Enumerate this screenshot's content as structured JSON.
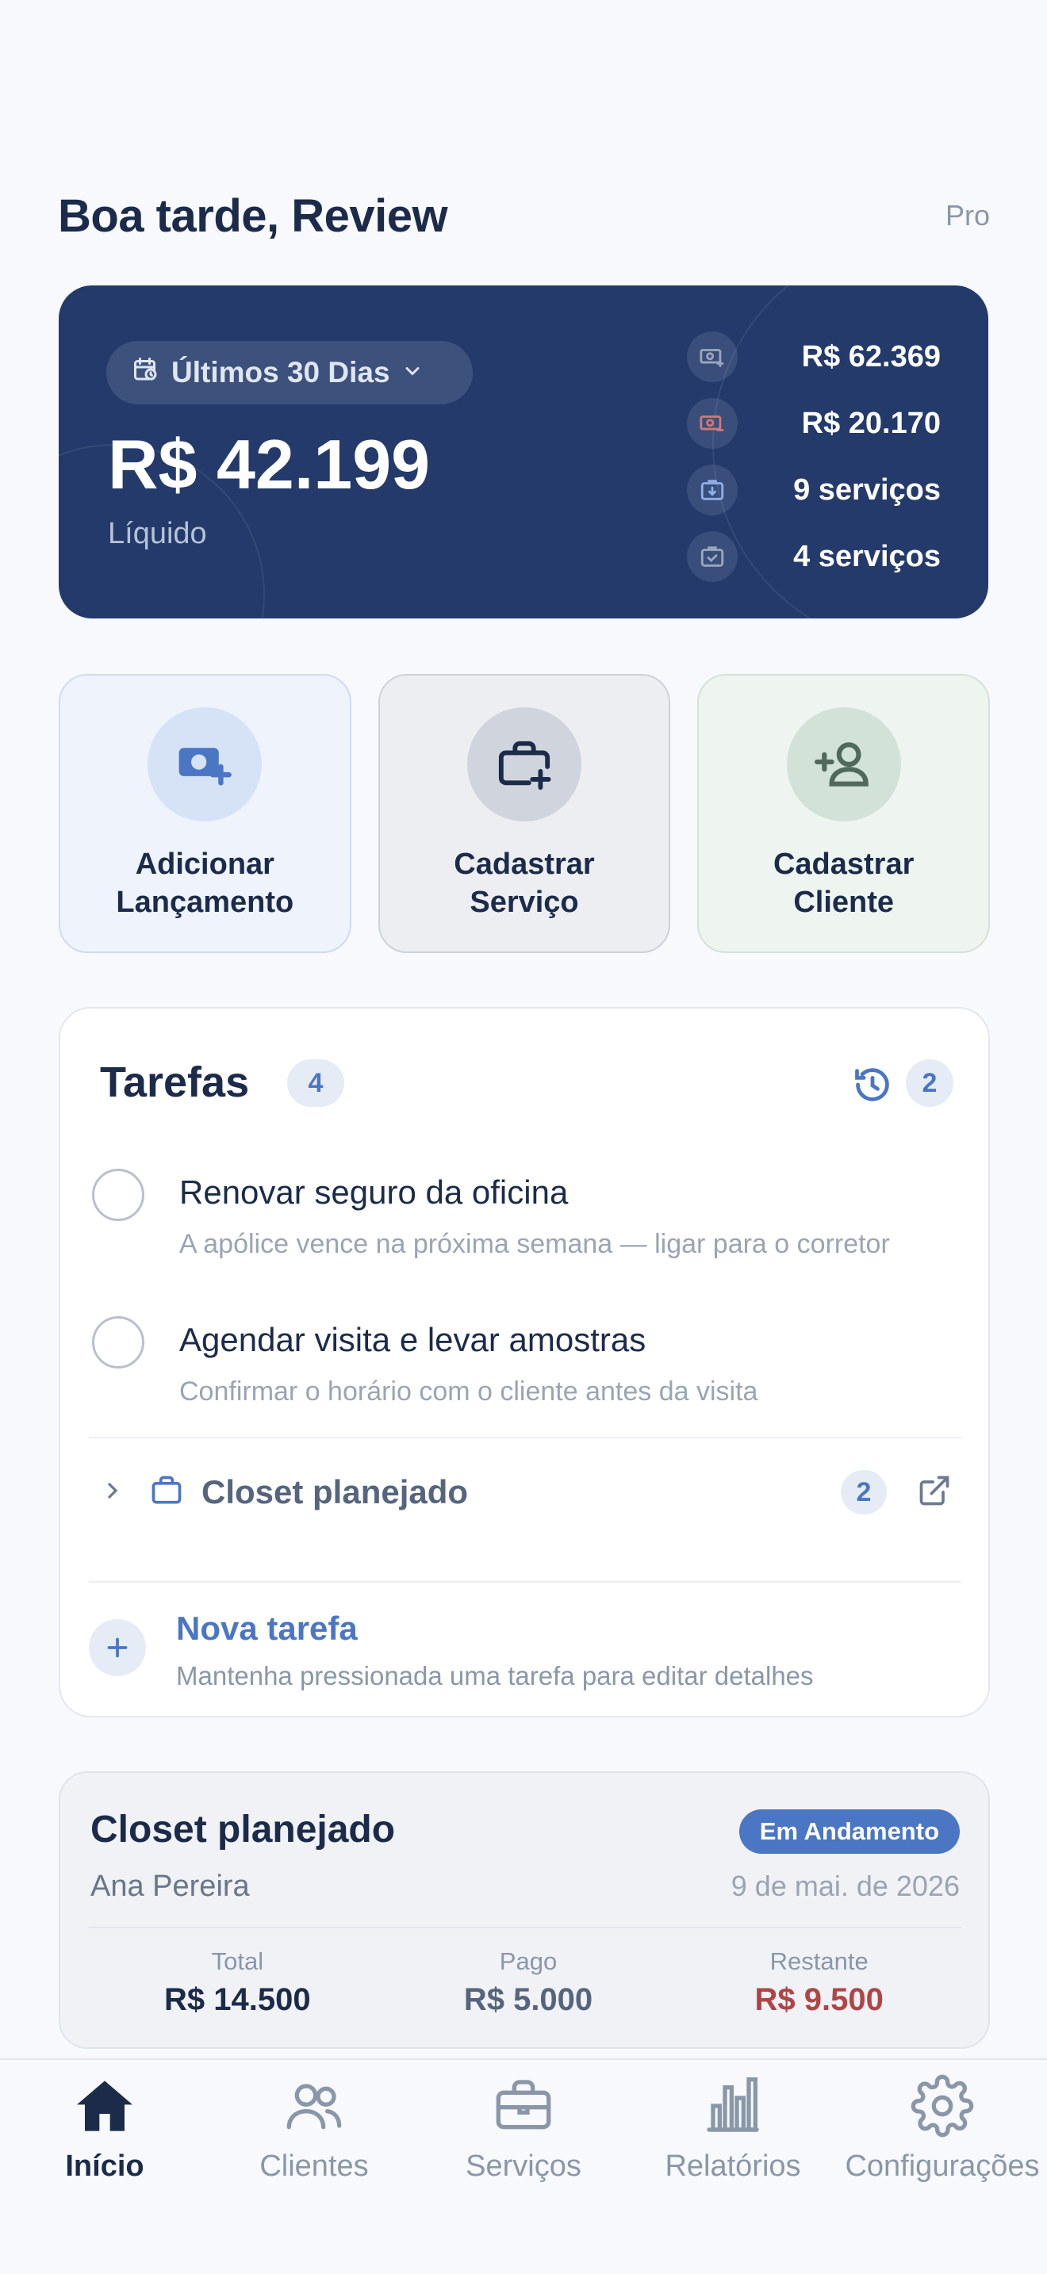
{
  "header": {
    "greeting": "Boa tarde, Review",
    "plan": "Pro"
  },
  "summary": {
    "period": "Últimos 30 Dias",
    "net_value": "R$ 42.199",
    "net_label": "Líquido",
    "stats": [
      {
        "icon": "money-in-icon",
        "value": "R$ 62.369"
      },
      {
        "icon": "money-out-icon",
        "value": "R$ 20.170"
      },
      {
        "icon": "box-download-icon",
        "value": "9 serviços"
      },
      {
        "icon": "clipboard-check-icon",
        "value": "4 serviços"
      }
    ]
  },
  "actions": [
    {
      "label_line1": "Adicionar",
      "label_line2": "Lançamento",
      "icon": "money-add-icon"
    },
    {
      "label_line1": "Cadastrar",
      "label_line2": "Serviço",
      "icon": "briefcase-add-icon"
    },
    {
      "label_line1": "Cadastrar",
      "label_line2": "Cliente",
      "icon": "user-add-icon"
    }
  ],
  "tasks": {
    "title": "Tarefas",
    "count": "4",
    "history_count": "2",
    "items": [
      {
        "title": "Renovar seguro da oficina",
        "desc": "A apólice vence na próxima semana — ligar para o corretor"
      },
      {
        "title": "Agendar visita e levar amostras",
        "desc": "Confirmar o horário com o cliente antes da visita"
      }
    ],
    "group": {
      "label": "Closet planejado",
      "count": "2"
    },
    "new_task": {
      "title": "Nova tarefa",
      "hint": "Mantenha pressionada uma tarefa para editar detalhes"
    }
  },
  "project": {
    "title": "Closet planejado",
    "status": "Em Andamento",
    "client": "Ana Pereira",
    "date": "9 de mai. de 2026",
    "total_label": "Total",
    "total_value": "R$ 14.500",
    "paid_label": "Pago",
    "paid_value": "R$ 5.000",
    "remaining_label": "Restante",
    "remaining_value": "R$ 9.500"
  },
  "nav": [
    {
      "label": "Início",
      "icon": "home-icon",
      "active": true
    },
    {
      "label": "Clientes",
      "icon": "users-icon"
    },
    {
      "label": "Serviços",
      "icon": "briefcase-icon"
    },
    {
      "label": "Relatórios",
      "icon": "bar-chart-icon"
    },
    {
      "label": "Configurações",
      "icon": "gear-icon"
    }
  ],
  "colors": {
    "primary": "#233a6b",
    "accent": "#4a76c4",
    "danger": "#b04545",
    "paid": "#55657d"
  }
}
